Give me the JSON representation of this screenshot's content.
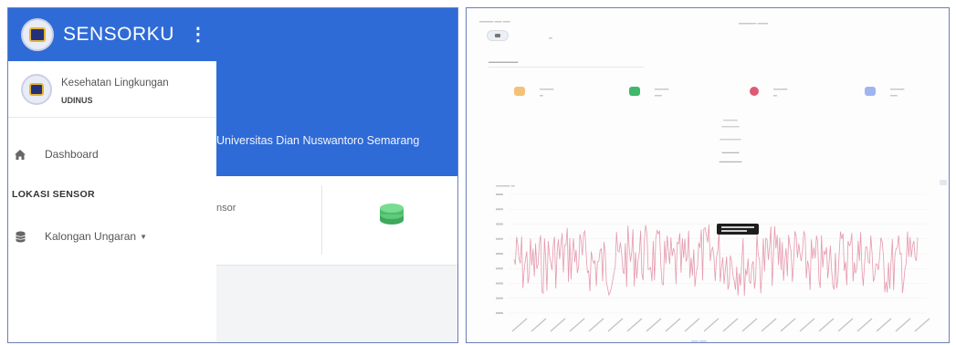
{
  "app": {
    "brand": "SENSORKU",
    "menu_icon": "kebab-menu-icon"
  },
  "sidebar": {
    "org_name": "Kesehatan Lingkungan",
    "org_sub": "UDINUS",
    "items": [
      {
        "label": "Dashboard",
        "icon": "home-icon"
      }
    ],
    "section_title": "LOKASI SENSOR",
    "locations": [
      {
        "label": "Kalongan Ungaran",
        "icon": "database-icon"
      }
    ]
  },
  "main": {
    "hero_text": "Universitas Dian Nuswantoro Semarang",
    "card_text": "nsor",
    "card_icon": "coins-icon"
  },
  "colors": {
    "primary": "#2f6bd6",
    "chart_line": "#e69aae",
    "card_icon": "#56c271"
  },
  "dashboard_preview": {
    "chart": {
      "type": "line",
      "series_color": "#e69aae",
      "tooltip_visible": true
    },
    "stat_icon_colors": [
      "#f0a95a",
      "#3fb86b",
      "#e05a74",
      "#7f9be6"
    ]
  }
}
